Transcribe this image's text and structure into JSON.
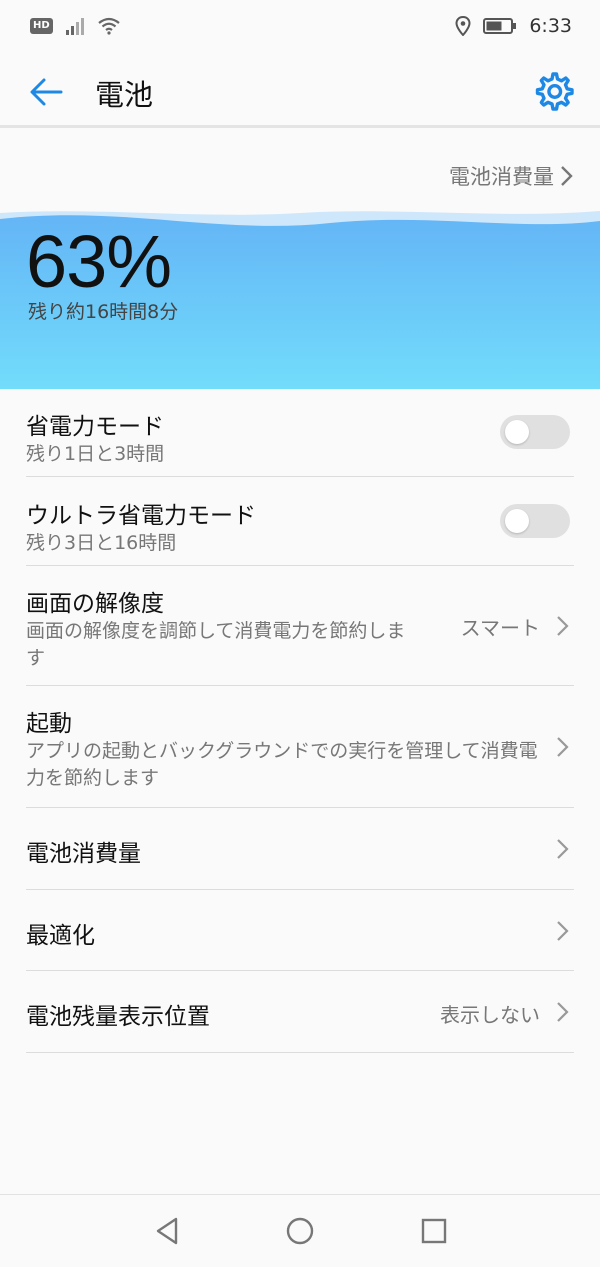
{
  "status_bar": {
    "hd": "HD",
    "time": "6:33",
    "icons": [
      "hd-icon",
      "signal-icon",
      "wifi-icon",
      "location-icon",
      "battery-icon"
    ]
  },
  "app_bar": {
    "title": "電池",
    "back_icon": "arrow-left-icon",
    "settings_icon": "gear-icon"
  },
  "battery": {
    "usage_link": "電池消費量",
    "percent": "63%",
    "level": 0.63,
    "remaining": "残り約16時間8分"
  },
  "list": {
    "power_saving": {
      "title": "省電力モード",
      "subtitle": "残り1日と3時間",
      "enabled": false
    },
    "ultra_power_saving": {
      "title": "ウルトラ省電力モード",
      "subtitle": "残り3日と16時間",
      "enabled": false
    },
    "resolution": {
      "title": "画面の解像度",
      "subtitle": "画面の解像度を調節して消費電力を節約します",
      "value": "スマート"
    },
    "launch": {
      "title": "起動",
      "subtitle": "アプリの起動とバックグラウンドでの実行を管理して消費電力を節約します"
    },
    "usage": {
      "title": "電池消費量"
    },
    "optimize": {
      "title": "最適化"
    },
    "percentage_position": {
      "title": "電池残量表示位置",
      "value": "表示しない"
    }
  },
  "colors": {
    "accent": "#1e88e5",
    "wave_top": "#64b5f6",
    "wave_bottom": "#6fd9fb"
  },
  "nav_bar": [
    "back-triangle-icon",
    "home-circle-icon",
    "recents-square-icon"
  ]
}
